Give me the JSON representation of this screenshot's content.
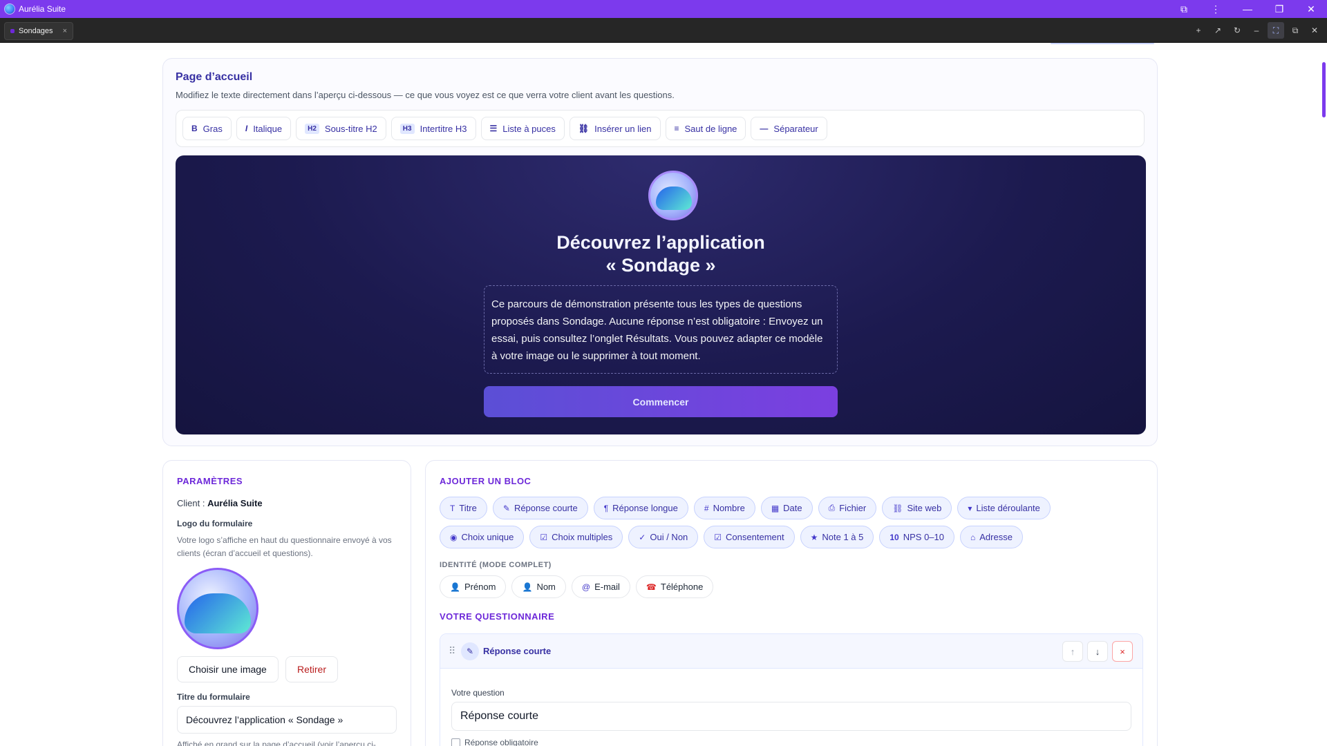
{
  "window": {
    "title": "Aurélia Suite"
  },
  "tabs": [
    {
      "label": "Sondages",
      "close": "×"
    }
  ],
  "welcome": {
    "title": "Page d’accueil",
    "subtitle": "Modifiez le texte directement dans l’aperçu ci-dessous — ce que vous voyez est ce que verra votre client avant les questions.",
    "toolbar": {
      "bold": "Gras",
      "italic": "Italique",
      "h2_tag": "H2",
      "h2": "Sous-titre H2",
      "h3_tag": "H3",
      "h3": "Intertitre H3",
      "bullets": "Liste à puces",
      "link": "Insérer un lien",
      "linebreak": "Saut de ligne",
      "separator": "Séparateur"
    },
    "preview": {
      "title_line1": "Découvrez l’application",
      "title_line2": "« Sondage »",
      "body": "Ce parcours de démonstration présente tous les types de questions proposés dans Sondage. Aucune réponse n’est obligatoire : Envoyez un essai, puis consultez l’onglet Résultats. Vous pouvez adapter ce modèle à votre image ou le supprimer à tout moment.",
      "start_button": "Commencer"
    }
  },
  "params": {
    "heading": "PARAMÈTRES",
    "client_label": "Client :",
    "client_name": "Aurélia Suite",
    "logo_label": "Logo du formulaire",
    "logo_help": "Votre logo s’affiche en haut du questionnaire envoyé à vos clients (écran d’accueil et questions).",
    "choose_image": "Choisir une image",
    "remove": "Retirer",
    "form_title_label": "Titre du formulaire",
    "form_title_value": "Découvrez l’application « Sondage »",
    "form_title_help": "Affiché en grand sur la page d’accueil (voir l’aperçu ci-"
  },
  "blocks": {
    "heading": "AJOUTER UN BLOC",
    "row1": [
      {
        "icon": "T",
        "label": "Titre"
      },
      {
        "icon": "✎",
        "label": "Réponse courte"
      },
      {
        "icon": "¶",
        "label": "Réponse longue"
      },
      {
        "icon": "#",
        "label": "Nombre"
      },
      {
        "icon": "▦",
        "label": "Date"
      },
      {
        "icon": "⎙",
        "label": "Fichier"
      },
      {
        "icon": "⛓",
        "label": "Site web"
      },
      {
        "icon": "▾",
        "label": "Liste déroulante"
      }
    ],
    "row2": [
      {
        "icon": "◉",
        "label": "Choix unique"
      },
      {
        "icon": "☑",
        "label": "Choix multiples"
      },
      {
        "icon": "✓",
        "label": "Oui / Non"
      },
      {
        "icon": "☑",
        "label": "Consentement"
      },
      {
        "icon": "★",
        "label": "Note 1 à 5"
      },
      {
        "icon": "10",
        "label": "NPS 0–10"
      },
      {
        "icon": "⌂",
        "label": "Adresse"
      }
    ],
    "identity_heading": "IDENTITÉ (MODE COMPLET)",
    "identity": [
      {
        "icon": "👤",
        "label": "Prénom"
      },
      {
        "icon": "👤",
        "label": "Nom"
      },
      {
        "icon": "@",
        "label": "E-mail"
      },
      {
        "icon": "☎",
        "label": "Téléphone"
      }
    ]
  },
  "questionnaire": {
    "heading": "VOTRE QUESTIONNAIRE",
    "question": {
      "type": "Réponse courte",
      "label": "Votre question",
      "value": "Réponse courte",
      "required": "Réponse obligatoire"
    }
  },
  "colors": {
    "accent": "#7c3aed",
    "brand_dark": "#3730a3"
  }
}
